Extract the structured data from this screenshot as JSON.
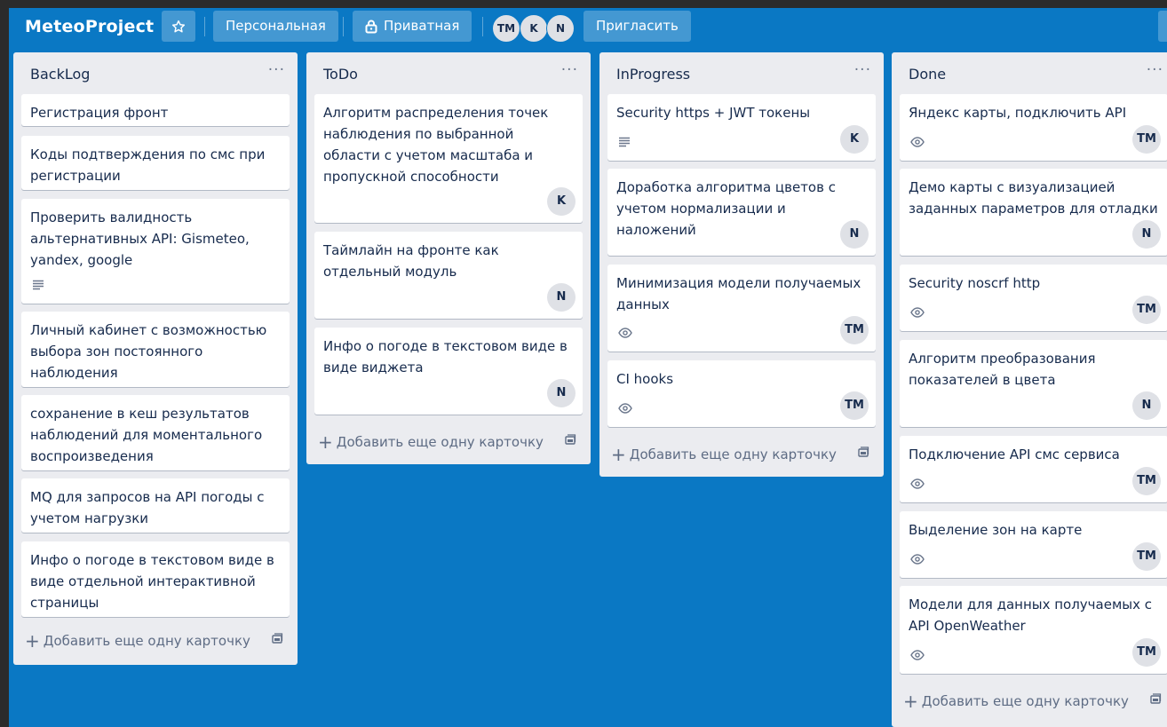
{
  "board": {
    "title": "MeteoProject",
    "team_label": "Персональная",
    "visibility_label": "Приватная",
    "invite_label": "Пригласить",
    "members": [
      "TM",
      "K",
      "N"
    ]
  },
  "add_card_label": "Добавить еще одну карточку",
  "menu_label": "···",
  "lists": [
    {
      "title": "BackLog",
      "cards": [
        {
          "title": "Регистрация фронт"
        },
        {
          "title": "Коды подтверждения по смс при регистрации"
        },
        {
          "title": "Проверить валидность альтернативных API: Gismeteo, yandex, google",
          "badge": "description-icon"
        },
        {
          "title": "Личный кабинет с возможностью выбора зон постоянного наблюдения"
        },
        {
          "title": "сохранение в кеш результатов наблюдений для моментального воспроизведения"
        },
        {
          "title": "MQ для запросов на API погоды с учетом нагрузки"
        },
        {
          "title": "Инфо о погоде в текстовом виде в виде отдельной интерактивной страницы"
        }
      ]
    },
    {
      "title": "ToDo",
      "cards": [
        {
          "title": "Алгоритм распределения точек наблюдения по выбранной области с учетом масштаба и пропускной способности",
          "member": "K"
        },
        {
          "title": "Таймлайн на фронте как отдельный модуль",
          "member": "N"
        },
        {
          "title": "Инфо о погоде в текстовом виде в виде виджета",
          "member": "N"
        }
      ]
    },
    {
      "title": "InProgress",
      "cards": [
        {
          "title": "Security https + JWT токены",
          "badge": "description-icon",
          "member": "K"
        },
        {
          "title": "Доработка алгоритма цветов с учетом нормализации и наложений",
          "member": "N"
        },
        {
          "title": "Минимизация модели получаемых данных",
          "badge": "watch-icon",
          "member": "TM"
        },
        {
          "title": "CI hooks",
          "badge": "watch-icon",
          "member": "TM"
        }
      ]
    },
    {
      "title": "Done",
      "cards": [
        {
          "title": "Яндекс карты, подключить API",
          "badge": "watch-icon",
          "member": "TM"
        },
        {
          "title": "Демо карты с визуализацией заданных параметров для отладки",
          "member": "N"
        },
        {
          "title": "Security noscrf http",
          "badge": "watch-icon",
          "member": "TM"
        },
        {
          "title": "Алгоритм преобразования показателей в цвета",
          "member": "N"
        },
        {
          "title": "Подключение API смс сервиса",
          "badge": "watch-icon",
          "member": "TM"
        },
        {
          "title": "Выделение зон на карте",
          "badge": "watch-icon",
          "member": "TM"
        },
        {
          "title": "Модели для данных получаемых с API OpenWeather",
          "badge": "watch-icon",
          "member": "TM"
        }
      ]
    }
  ],
  "colors": {
    "board_bg": "#0a78c4",
    "list_bg": "#ebecf0",
    "card_bg": "#ffffff",
    "text": "#172b4d"
  }
}
